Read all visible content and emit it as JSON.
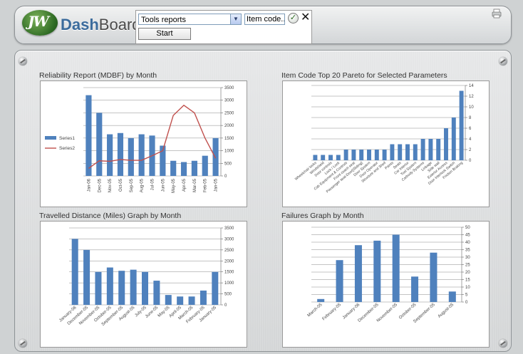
{
  "header": {
    "logo_mark": "JW",
    "logo_text_a": "Dash",
    "logo_text_b": "Board",
    "report_select": "Tools reports",
    "item_code_placeholder": "Item code...",
    "ok_icon": "check-circle-icon",
    "close_icon": "close-icon",
    "start_label": "Start",
    "print_icon": "printer-icon"
  },
  "panels": {
    "p1_title": "Reliability Report (MDBF) by Month",
    "p2_title": "Item Code Top 20 Pareto for Selected Parameters",
    "p3_title": "Travelled Distance (Miles) Graph by Month",
    "p4_title": "Failures Graph by Month"
  },
  "colors": {
    "bar": "#4f81bd",
    "line": "#c0504d"
  },
  "chart_data": [
    {
      "type": "bar",
      "title": "Reliability Report (MDBF) by Month",
      "categories": [
        "Jan-06",
        "Dec-05",
        "Nov-05",
        "Oct-05",
        "Sep-05",
        "Aug-05",
        "Jul-05",
        "Jun-05",
        "May-05",
        "Apr-05",
        "Mar-05",
        "Feb-05",
        "Jan-05"
      ],
      "series": [
        {
          "name": "Series1",
          "values": [
            3200,
            2500,
            1650,
            1700,
            1500,
            1650,
            1600,
            1200,
            600,
            550,
            600,
            800,
            1500
          ]
        },
        {
          "name": "Series2",
          "values": [
            300,
            600,
            580,
            650,
            620,
            620,
            800,
            1000,
            2400,
            2800,
            2500,
            1500,
            700
          ]
        }
      ],
      "ylim": [
        0,
        3500
      ],
      "yticks": [
        0,
        500,
        1000,
        1500,
        2000,
        2500,
        3000,
        3500
      ],
      "legend": "left"
    },
    {
      "type": "bar",
      "title": "Item Code Top 20 Pareto for Selected Parameters",
      "categories": [
        "Wheelchair locks",
        "Windshield",
        "Door controls",
        "Lock / Lock",
        "Cab Equipment & Controls",
        "Front coach seat",
        "Passenger seat-Door[Sliding]",
        "Door System",
        "Door Operator",
        "Structure and Shell",
        "Paints",
        "Seats",
        "Car Interior",
        "Tool System",
        "Carbody Systems",
        "Linkage",
        "Side wall",
        "Exterior Access",
        "Door Interlock Switch",
        "Friction Braking"
      ],
      "values": [
        1,
        1,
        1,
        1,
        2,
        2,
        2,
        2,
        2,
        2,
        3,
        3,
        3,
        3,
        4,
        4,
        4,
        6,
        8,
        13
      ],
      "ylim": [
        0,
        14
      ],
      "yticks": [
        0,
        2,
        4,
        6,
        8,
        10,
        12,
        14
      ]
    },
    {
      "type": "bar",
      "title": "Travelled Distance (Miles) Graph by Month",
      "categories": [
        "January-06",
        "December-05",
        "November-05",
        "October-05",
        "September-05",
        "August-05",
        "July-05",
        "June-05",
        "May-05",
        "April-05",
        "March-05",
        "February-05",
        "January-05"
      ],
      "values": [
        3000,
        2500,
        1500,
        1700,
        1550,
        1600,
        1500,
        1100,
        450,
        380,
        380,
        650,
        1500
      ],
      "ylim": [
        0,
        3500
      ],
      "yticks": [
        0,
        500,
        1000,
        1500,
        2000,
        2500,
        3000,
        3500
      ]
    },
    {
      "type": "bar",
      "title": "Failures Graph by Month",
      "categories": [
        "March-05",
        "February-05",
        "January-06",
        "December-05",
        "November-05",
        "October-05",
        "September-05",
        "August-05"
      ],
      "values": [
        2,
        28,
        38,
        41,
        45,
        17,
        33,
        7
      ],
      "ylim": [
        0,
        50
      ],
      "yticks": [
        0,
        5,
        10,
        15,
        20,
        25,
        30,
        35,
        40,
        45,
        50
      ]
    }
  ]
}
